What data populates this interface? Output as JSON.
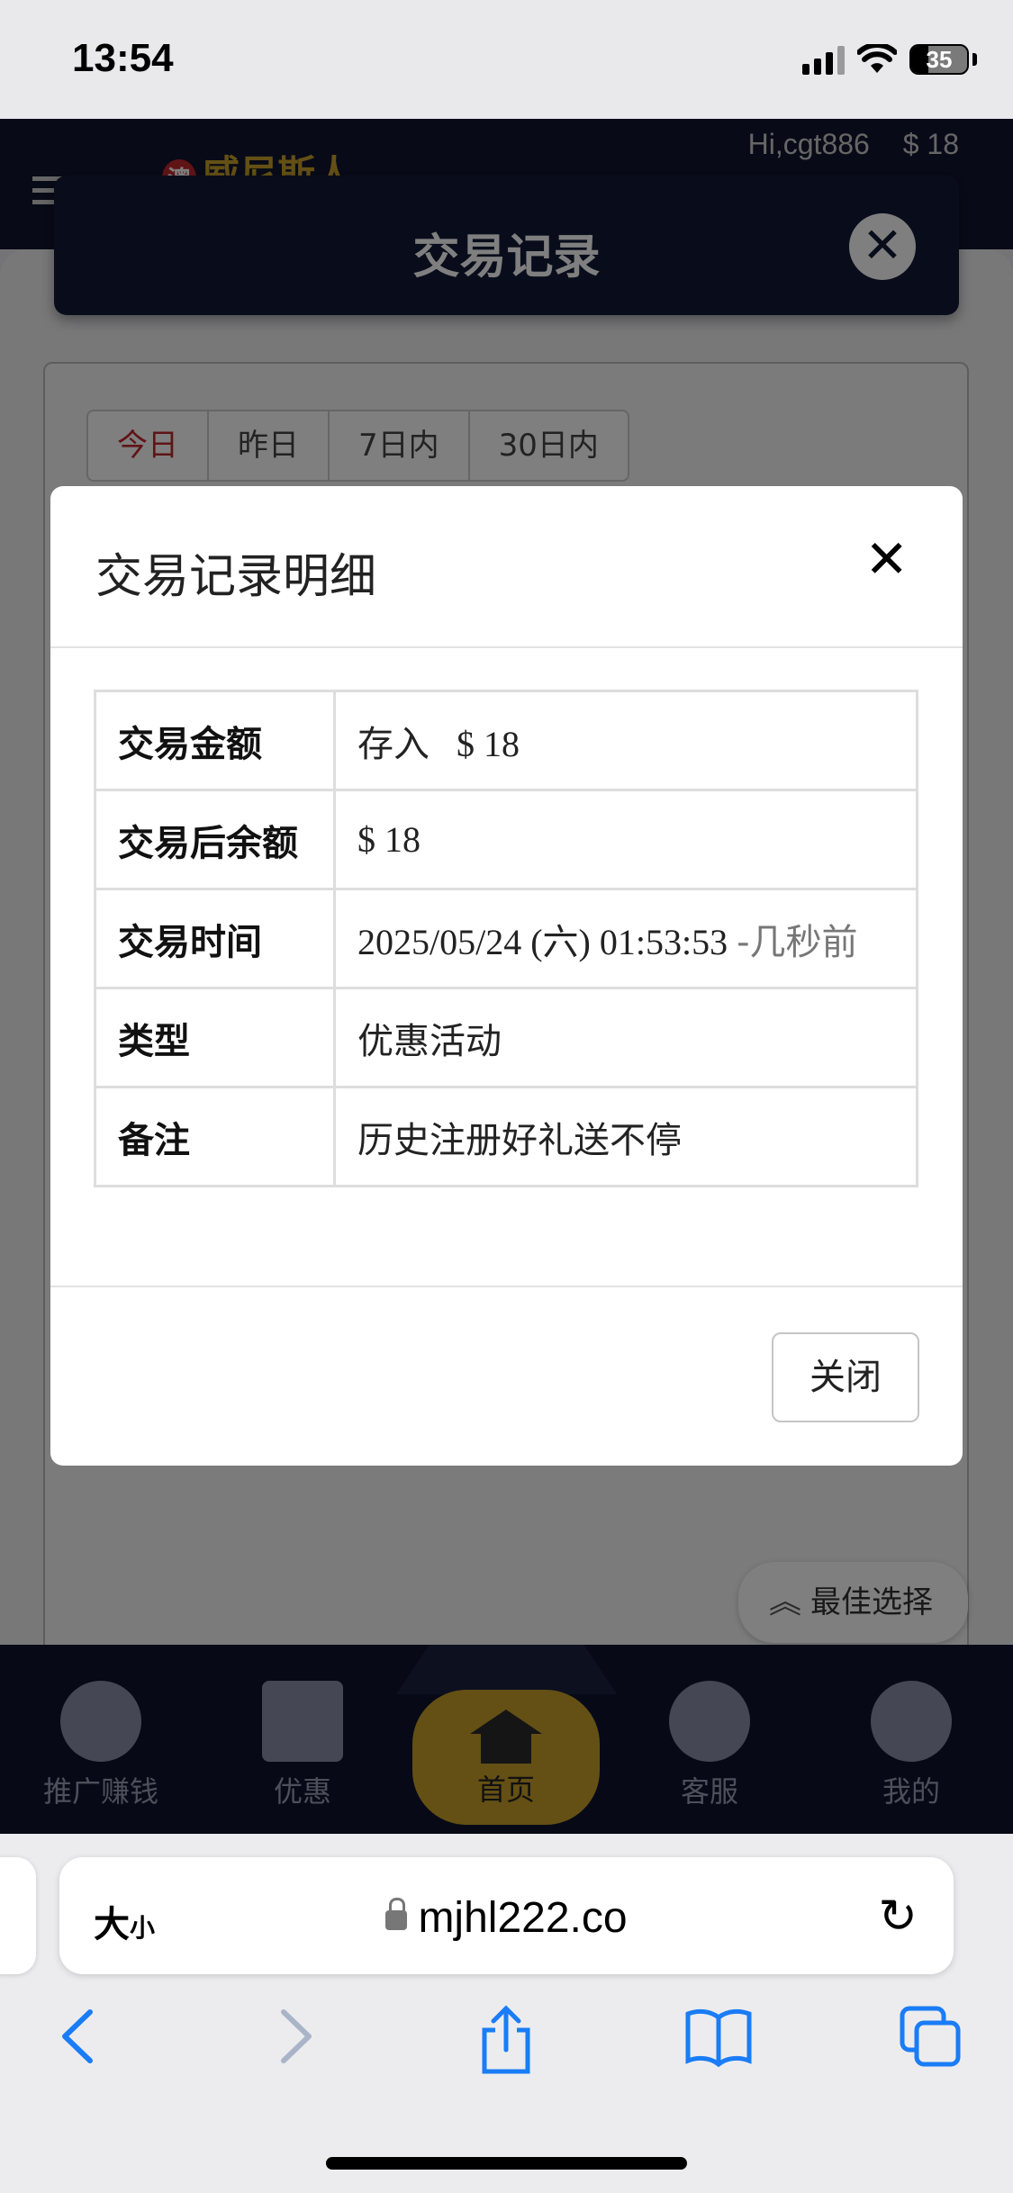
{
  "status_bar": {
    "time": "13:54",
    "battery": "35"
  },
  "background": {
    "brand": "威尼斯人",
    "brand_badge": "澳",
    "greeting": "Hi,cgt886",
    "balance": "$ 18",
    "modal_title": "交易记录",
    "date_tabs": [
      "今日",
      "昨日",
      "7日内",
      "30日内"
    ],
    "best_choice": "最佳选择",
    "nav": {
      "promote": "推广赚钱",
      "offers": "优惠",
      "home": "首页",
      "service": "客服",
      "mine": "我的"
    }
  },
  "dialog": {
    "title": "交易记录明细",
    "close_label": "关闭",
    "rows": {
      "amount": {
        "label": "交易金额",
        "type": "存入",
        "value": "$ 18"
      },
      "balance_after": {
        "label": "交易后余额",
        "value": "$ 18"
      },
      "time": {
        "label": "交易时间",
        "value": "2025/05/24 (六) 01:53:53",
        "relative": "-几秒前"
      },
      "category": {
        "label": "类型",
        "value": "优惠活动"
      },
      "remark": {
        "label": "备注",
        "value": "历史注册好礼送不停"
      }
    }
  },
  "safari": {
    "text_size_label": "大",
    "text_size_small": "小",
    "url": "mjhl222.co"
  },
  "colors": {
    "deposit_green": "#3f7d37",
    "ios_blue": "#1a7cf6",
    "nav_dark": "#0f142c"
  }
}
